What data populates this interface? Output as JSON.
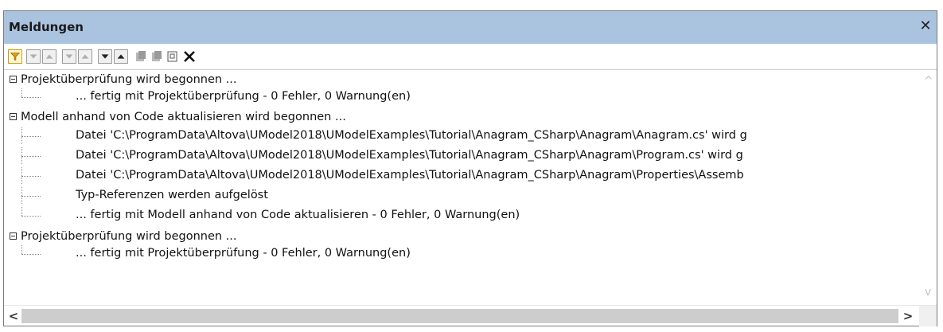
{
  "panel": {
    "title": "Meldungen",
    "close_glyph": "✕"
  },
  "toolbar": {
    "buttons": [
      "filter-icon",
      "next-warning-down-icon",
      "prev-warning-up-icon",
      "next-error-down-icon",
      "prev-error-up-icon",
      "next-down-icon",
      "prev-up-icon",
      "copy-line-icon",
      "copy-all-icon",
      "find-icon",
      "clear-icon"
    ]
  },
  "messages": [
    {
      "kind": "header",
      "text": "Projektüberprüfung wird begonnen ..."
    },
    {
      "kind": "child",
      "text": "... fertig mit Projektüberprüfung - 0 Fehler, 0 Warnung(en)"
    },
    {
      "kind": "header",
      "text": "Modell anhand von Code aktualisieren wird begonnen ..."
    },
    {
      "kind": "child",
      "text": "Datei 'C:\\ProgramData\\Altova\\UModel2018\\UModelExamples\\Tutorial\\Anagram_CSharp\\Anagram\\Anagram.cs' wird g"
    },
    {
      "kind": "child",
      "text": "Datei 'C:\\ProgramData\\Altova\\UModel2018\\UModelExamples\\Tutorial\\Anagram_CSharp\\Anagram\\Program.cs' wird g"
    },
    {
      "kind": "child",
      "text": "Datei 'C:\\ProgramData\\Altova\\UModel2018\\UModelExamples\\Tutorial\\Anagram_CSharp\\Anagram\\Properties\\Assemb"
    },
    {
      "kind": "child",
      "text": "Typ-Referenzen werden aufgelöst"
    },
    {
      "kind": "child",
      "text": "... fertig mit Modell anhand von Code aktualisieren - 0 Fehler, 0 Warnung(en)"
    },
    {
      "kind": "header",
      "text": "Projektüberprüfung wird begonnen ..."
    },
    {
      "kind": "child",
      "text": "... fertig mit Projektüberprüfung - 0 Fehler, 0 Warnung(en)"
    }
  ],
  "scroll": {
    "up": "^",
    "down": "v",
    "left": "<",
    "right": ">"
  }
}
